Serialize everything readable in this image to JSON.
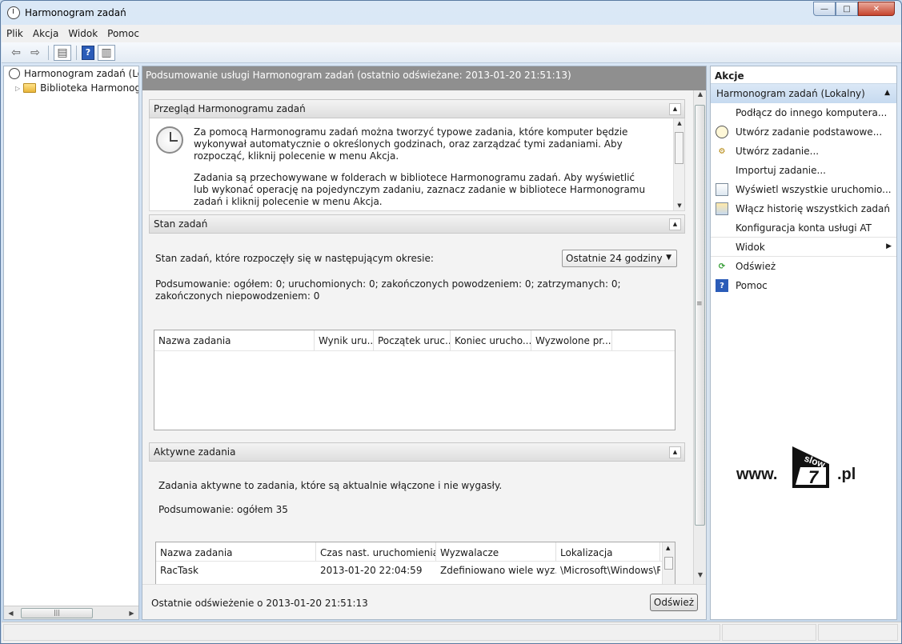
{
  "window": {
    "title": "Harmonogram zadań"
  },
  "menu": [
    "Plik",
    "Akcja",
    "Widok",
    "Pomoc"
  ],
  "tree": {
    "root": "Harmonogram zadań (Lokalny)",
    "child": "Biblioteka Harmonogramu zadań"
  },
  "center": {
    "header": "Podsumowanie usługi Harmonogram zadań (ostatnio odświeżane: 2013-01-20 21:51:13)",
    "overview": {
      "title": "Przegląd Harmonogramu zadań",
      "p1": "Za pomocą Harmonogramu zadań można tworzyć typowe zadania, które komputer będzie wykonywał automatycznie o określonych godzinach, oraz zarządzać tymi zadaniami. Aby rozpocząć, kliknij polecenie w menu Akcja.",
      "p2": "Zadania są przechowywane w folderach w bibliotece Harmonogramu zadań. Aby wyświetlić lub wykonać operację na pojedynczym zadaniu, zaznacz zadanie w bibliotece Harmonogramu zadań i kliknij polecenie w menu Akcja."
    },
    "status": {
      "title": "Stan zadań",
      "period_label": "Stan zadań, które rozpoczęły się w następującym okresie:",
      "period_value": "Ostatnie 24 godziny",
      "summary": "Podsumowanie: ogółem: 0; uruchomionych: 0; zakończonych powodzeniem: 0; zatrzymanych: 0; zakończonych niepowodzeniem: 0",
      "columns": [
        "Nazwa zadania",
        "Wynik uru...",
        "Początek uruc...",
        "Koniec urucho...",
        "Wyzwolone pr..."
      ]
    },
    "active": {
      "title": "Aktywne zadania",
      "description": "Zadania aktywne to zadania, które są aktualnie włączone i nie wygasły.",
      "summary": "Podsumowanie: ogółem 35",
      "columns": [
        "Nazwa zadania",
        "Czas nast. uruchomienia",
        "Wyzwalacze",
        "Lokalizacja"
      ],
      "rows": [
        [
          "RacTask",
          "2013-01-20 22:04:59",
          "Zdefiniowano wiele wyz...",
          "\\Microsoft\\Windows\\R"
        ]
      ]
    },
    "last_refresh": "Ostatnie odświeżenie o 2013-01-20 21:51:13",
    "refresh_button": "Odśwież"
  },
  "actions": {
    "title": "Akcje",
    "group": "Harmonogram zadań (Lokalny)",
    "items": [
      {
        "label": "Podłącz do innego komputera...",
        "icon": "none"
      },
      {
        "label": "Utwórz zadanie podstawowe...",
        "icon": "clock-icon"
      },
      {
        "label": "Utwórz zadanie...",
        "icon": "gear-icon"
      },
      {
        "label": "Importuj zadanie...",
        "icon": "none"
      },
      {
        "label": "Wyświetl wszystkie uruchomio...",
        "icon": "list-icon"
      },
      {
        "label": "Włącz historię wszystkich zadań",
        "icon": "history-icon"
      },
      {
        "label": "Konfiguracja konta usługi AT",
        "icon": "none"
      },
      {
        "label": "Widok",
        "icon": "none"
      },
      {
        "label": "Odśwież",
        "icon": "refresh-icon"
      },
      {
        "label": "Pomoc",
        "icon": "help-icon"
      }
    ]
  },
  "logo": {
    "prefix": "www.",
    "badge_top": "slow",
    "badge_num": "7",
    "suffix": ".pl"
  }
}
